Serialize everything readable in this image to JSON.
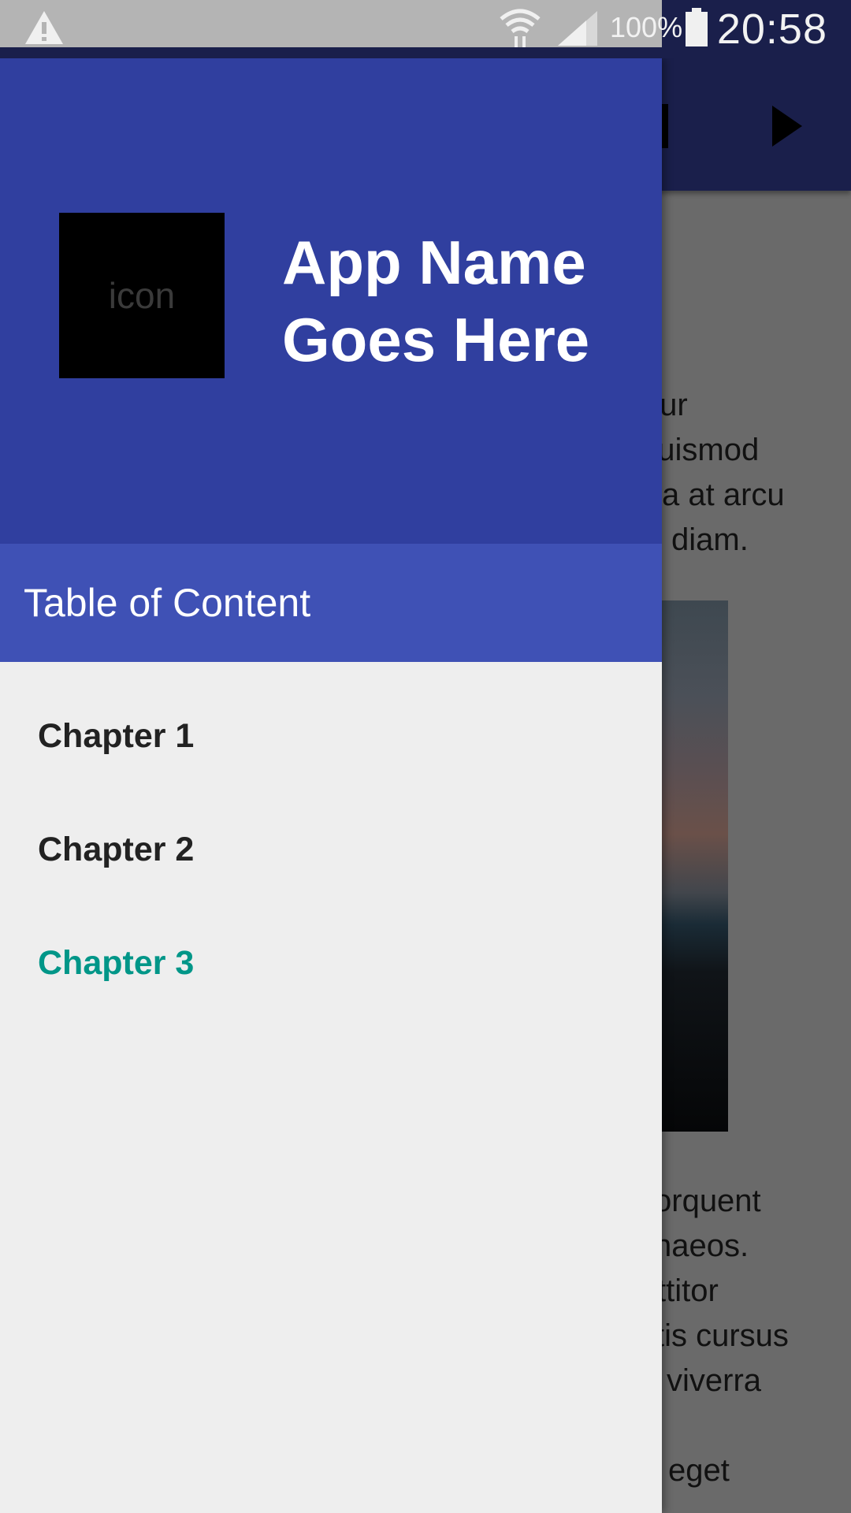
{
  "status_bar": {
    "battery_percent": "100%",
    "time": "20:58",
    "icons": [
      "warning-icon",
      "wifi-icon",
      "signal-icon",
      "battery-icon"
    ]
  },
  "drawer": {
    "icon_placeholder": "icon",
    "app_name_line1": "App Name",
    "app_name_line2": "Goes Here",
    "section_title": "Table of Content",
    "chapters": [
      {
        "label": "Chapter 1",
        "active": false
      },
      {
        "label": "Chapter 2",
        "active": false
      },
      {
        "label": "Chapter 3",
        "active": true
      }
    ]
  },
  "background_content": {
    "para1_lines": [
      "tur",
      "euismod",
      "a at arcu",
      "diam."
    ],
    "para2_lines": [
      "orquent",
      "naeos.",
      "ttitor",
      "tis cursus",
      "viverra",
      "",
      "eget"
    ]
  },
  "colors": {
    "header": "#303f9f",
    "toc_header": "#3f51b5",
    "active_chapter": "#009688",
    "drawer_bg": "#eeeeee"
  }
}
